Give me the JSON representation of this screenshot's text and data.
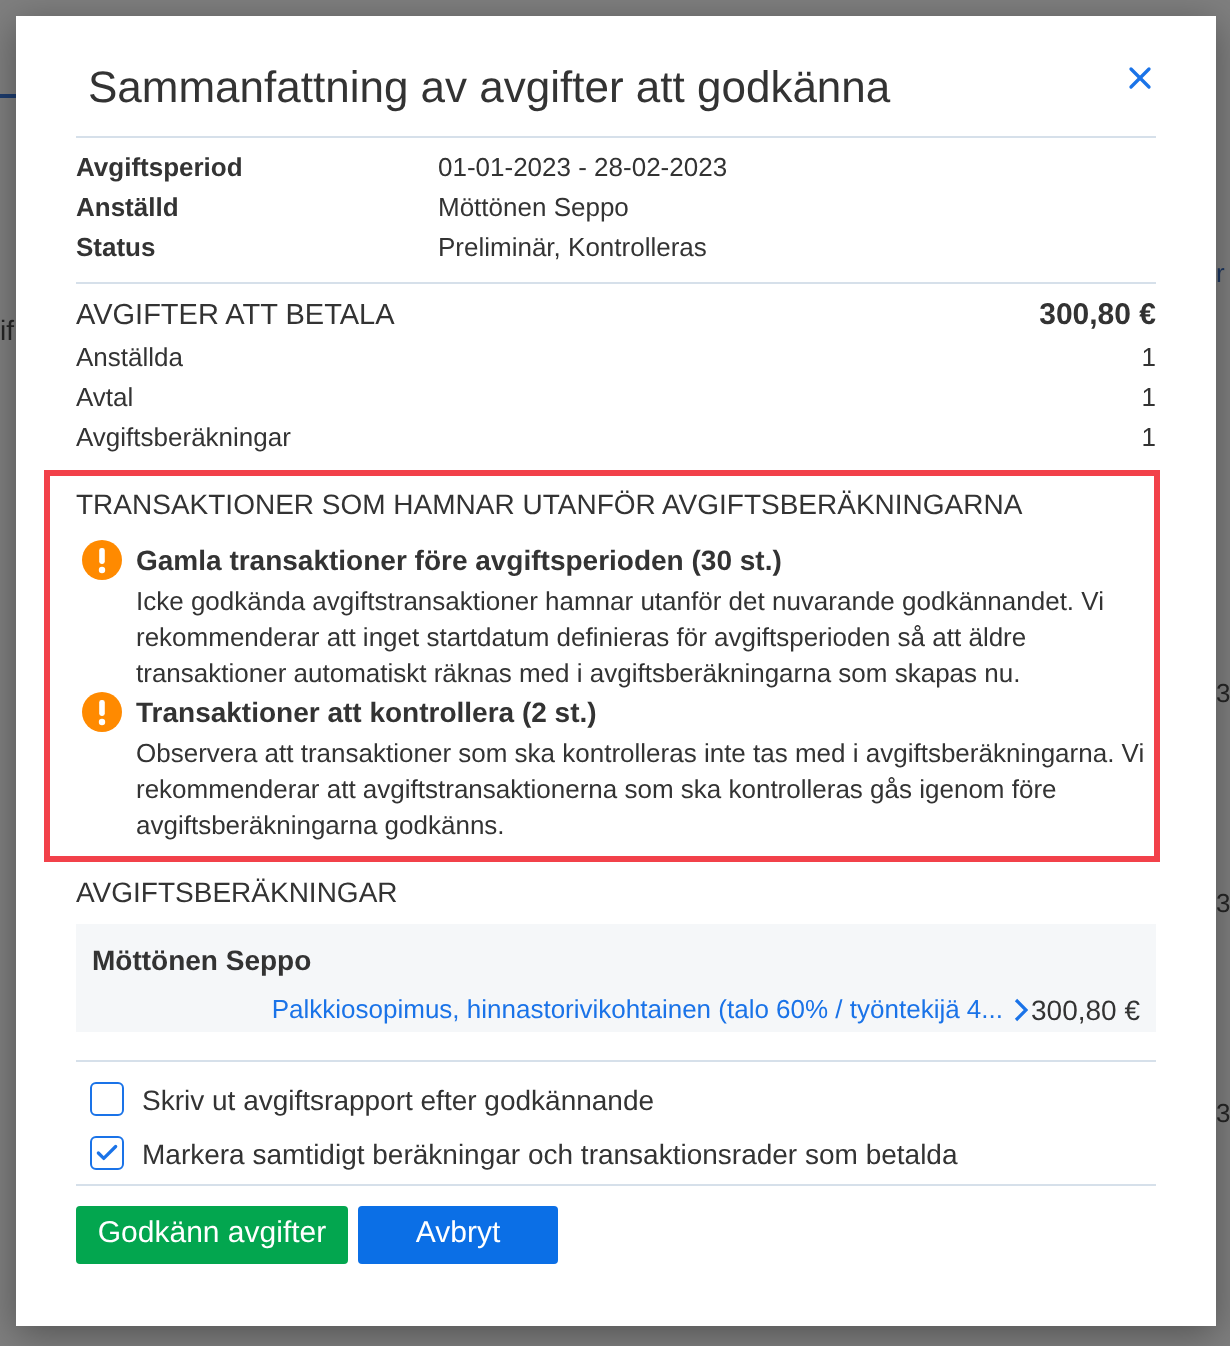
{
  "background": {
    "left_edge": [
      "if"
    ],
    "right_edge": [
      "r",
      "3",
      "3",
      "3"
    ]
  },
  "dialog": {
    "title": "Sammanfattning av avgifter att godkänna"
  },
  "details": [
    {
      "label": "Avgiftsperiod",
      "value": "01-01-2023 - 28-02-2023"
    },
    {
      "label": "Anställd",
      "value": "Möttönen Seppo"
    },
    {
      "label": "Status",
      "value": "Preliminär, Kontrolleras"
    }
  ],
  "fees": {
    "heading": "AVGIFTER ATT BETALA",
    "total": "300,80 €",
    "rows": [
      {
        "label": "Anställda",
        "value": "1"
      },
      {
        "label": "Avtal",
        "value": "1"
      },
      {
        "label": "Avgiftsberäkningar",
        "value": "1"
      }
    ]
  },
  "excluded_transactions": {
    "highlighted": true,
    "heading": "TRANSAKTIONER SOM HAMNAR UTANFÖR AVGIFTSBERÄKNINGARNA",
    "warnings": [
      {
        "title": "Gamla transaktioner före avgiftsperioden (30 st.)",
        "text": "Icke godkända avgiftstransaktioner hamnar utanför det nuvarande godkännandet. Vi rekommenderar att inget startdatum definieras för avgiftsperioden så att äldre transaktioner automatiskt räknas med i avgiftsberäkningarna som skapas nu."
      },
      {
        "title": "Transaktioner att kontrollera (2 st.)",
        "text": "Observera att transaktioner som ska kontrolleras inte tas med i avgiftsberäkningarna. Vi rekommenderar att avgiftstransaktionerna som ska kontrolleras gås igenom före avgiftsberäkningarna godkänns."
      }
    ]
  },
  "calculations": {
    "heading": "AVGIFTSBERÄKNINGAR",
    "groups": [
      {
        "name": "Möttönen Seppo",
        "rows": [
          {
            "link": "Palkkiosopimus, hinnastorivikohtainen (talo 60% / työntekijä 4...",
            "amount": "300,80 €"
          }
        ]
      }
    ]
  },
  "options": [
    {
      "label": "Skriv ut avgiftsrapport efter godkännande",
      "checked": false
    },
    {
      "label": "Markera samtidigt beräkningar och transaktionsrader som betalda",
      "checked": true
    }
  ],
  "buttons": [
    {
      "label": "Godkänn avgifter",
      "kind": "primary"
    },
    {
      "label": "Avbryt",
      "kind": "secondary"
    }
  ]
}
